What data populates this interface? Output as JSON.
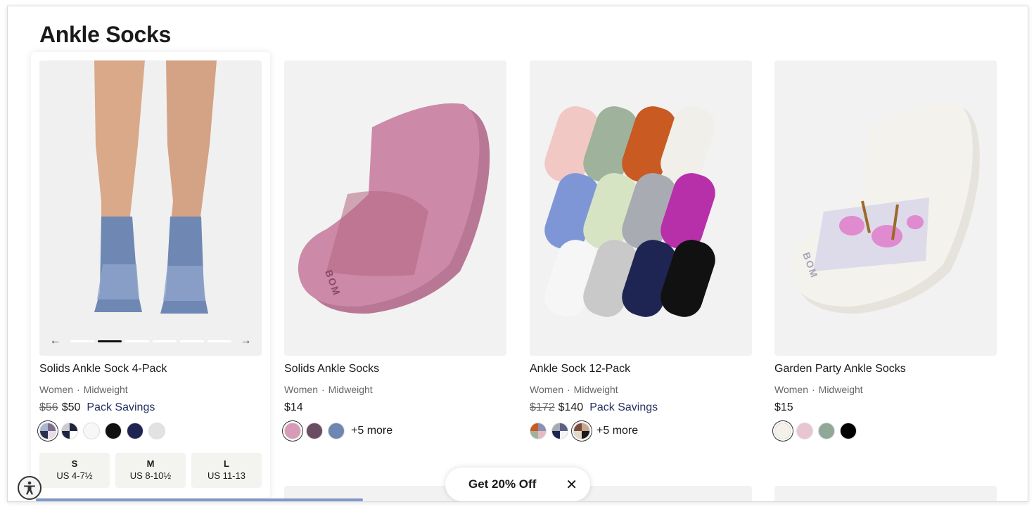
{
  "page": {
    "title": "Ankle Socks"
  },
  "products": [
    {
      "name": "Solids Ankle Sock 4-Pack",
      "audience": "Women",
      "weight": "Midweight",
      "old_price": "$56",
      "price": "$50",
      "badge": "Pack Savings",
      "swatches": [
        "#6b5f7c",
        "#1f2440",
        "#f5f5f5",
        "#111111",
        "#1f2552",
        "#e2e2e2"
      ],
      "sizes": [
        {
          "label": "S",
          "range": "US 4-7½"
        },
        {
          "label": "M",
          "range": "US 8-10½"
        },
        {
          "label": "L",
          "range": "US 11-13"
        }
      ]
    },
    {
      "name": "Solids Ankle Socks",
      "audience": "Women",
      "weight": "Midweight",
      "price": "$14",
      "swatches": [
        "#d79bb8",
        "#6b4d63",
        "#6d86b2"
      ],
      "more": "+5 more"
    },
    {
      "name": "Ankle Sock 12-Pack",
      "audience": "Women",
      "weight": "Midweight",
      "old_price": "$172",
      "price": "$140",
      "badge": "Pack Savings",
      "swatches": [
        "#8a8fb5",
        "#5d5f84",
        "#c9a98c"
      ],
      "more": "+5 more"
    },
    {
      "name": "Garden Party Ankle Socks",
      "audience": "Women",
      "weight": "Midweight",
      "price": "$15",
      "swatches": [
        "#f4f1ea",
        "#e9c6cf",
        "#8fa898",
        "#000000"
      ]
    }
  ],
  "separator": "·",
  "promo": {
    "text": "Get 20% Off"
  },
  "icons": {
    "accessibility": "accessibility-icon",
    "close": "close-icon",
    "prev": "arrow-left-icon",
    "next": "arrow-right-icon"
  }
}
